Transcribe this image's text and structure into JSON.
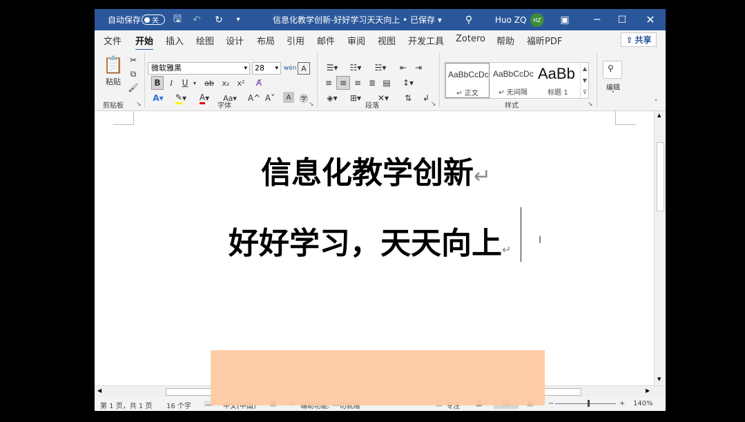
{
  "titlebar": {
    "autosave_label": "自动保存",
    "autosave_state": "关",
    "doc_title": "信息化教学创新-好好学习天天向上 • 已保存",
    "user_name": "Huo ZQ",
    "avatar_initials": "HZ",
    "search_icon": "search-icon"
  },
  "menu": {
    "items": [
      "文件",
      "开始",
      "插入",
      "绘图",
      "设计",
      "布局",
      "引用",
      "邮件",
      "审阅",
      "视图",
      "开发工具",
      "Zotero",
      "帮助",
      "福昕PDF"
    ],
    "active": "开始",
    "share_label": "共享"
  },
  "ribbon": {
    "clipboard": {
      "paste_label": "粘贴",
      "group_label": "剪贴板"
    },
    "font": {
      "font_name": "微软雅黑",
      "font_size": "28",
      "group_label": "字体",
      "bold": "B",
      "italic": "I",
      "underline": "U",
      "strike": "ab",
      "sub": "x₂",
      "sup": "x²",
      "change_case": "Aa",
      "grow": "A^",
      "shrink": "A˅"
    },
    "paragraph": {
      "group_label": "段落"
    },
    "styles": {
      "group_label": "样式",
      "items": [
        {
          "sample": "AaBbCcDc",
          "name": "↵ 正文"
        },
        {
          "sample": "AaBbCcDc",
          "name": "↵ 无间隔"
        },
        {
          "sample": "AaBb",
          "name": "标题 1"
        }
      ]
    },
    "editing": {
      "label": "编辑"
    }
  },
  "document": {
    "line1": "信息化教学创新",
    "line2": "好好学习，天天向上",
    "para_mark": "↵"
  },
  "status": {
    "page": "第 1 页，共 1 页",
    "words": "16 个字",
    "language": "中文(中国)",
    "accessibility": "辅助功能: 一切就绪",
    "focus": "专注",
    "zoom": "140%"
  },
  "colors": {
    "titlebar": "#2b579a",
    "avatar": "#3d8b3d",
    "overlay": "#ffc9a0"
  }
}
